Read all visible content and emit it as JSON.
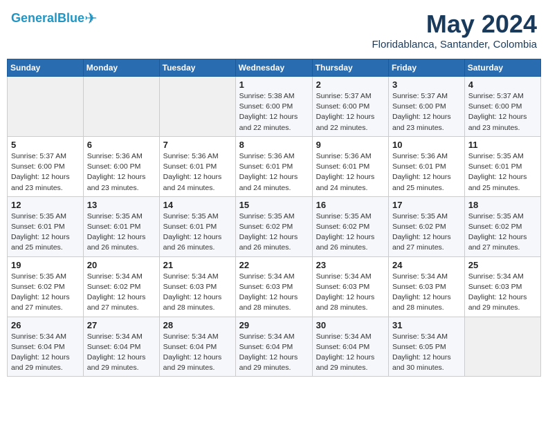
{
  "header": {
    "logo_general": "General",
    "logo_blue": "Blue",
    "month": "May 2024",
    "location": "Floridablanca, Santander, Colombia"
  },
  "weekdays": [
    "Sunday",
    "Monday",
    "Tuesday",
    "Wednesday",
    "Thursday",
    "Friday",
    "Saturday"
  ],
  "weeks": [
    [
      {
        "day": "",
        "info": ""
      },
      {
        "day": "",
        "info": ""
      },
      {
        "day": "",
        "info": ""
      },
      {
        "day": "1",
        "info": "Sunrise: 5:38 AM\nSunset: 6:00 PM\nDaylight: 12 hours\nand 22 minutes."
      },
      {
        "day": "2",
        "info": "Sunrise: 5:37 AM\nSunset: 6:00 PM\nDaylight: 12 hours\nand 22 minutes."
      },
      {
        "day": "3",
        "info": "Sunrise: 5:37 AM\nSunset: 6:00 PM\nDaylight: 12 hours\nand 23 minutes."
      },
      {
        "day": "4",
        "info": "Sunrise: 5:37 AM\nSunset: 6:00 PM\nDaylight: 12 hours\nand 23 minutes."
      }
    ],
    [
      {
        "day": "5",
        "info": "Sunrise: 5:37 AM\nSunset: 6:00 PM\nDaylight: 12 hours\nand 23 minutes."
      },
      {
        "day": "6",
        "info": "Sunrise: 5:36 AM\nSunset: 6:00 PM\nDaylight: 12 hours\nand 23 minutes."
      },
      {
        "day": "7",
        "info": "Sunrise: 5:36 AM\nSunset: 6:01 PM\nDaylight: 12 hours\nand 24 minutes."
      },
      {
        "day": "8",
        "info": "Sunrise: 5:36 AM\nSunset: 6:01 PM\nDaylight: 12 hours\nand 24 minutes."
      },
      {
        "day": "9",
        "info": "Sunrise: 5:36 AM\nSunset: 6:01 PM\nDaylight: 12 hours\nand 24 minutes."
      },
      {
        "day": "10",
        "info": "Sunrise: 5:36 AM\nSunset: 6:01 PM\nDaylight: 12 hours\nand 25 minutes."
      },
      {
        "day": "11",
        "info": "Sunrise: 5:35 AM\nSunset: 6:01 PM\nDaylight: 12 hours\nand 25 minutes."
      }
    ],
    [
      {
        "day": "12",
        "info": "Sunrise: 5:35 AM\nSunset: 6:01 PM\nDaylight: 12 hours\nand 25 minutes."
      },
      {
        "day": "13",
        "info": "Sunrise: 5:35 AM\nSunset: 6:01 PM\nDaylight: 12 hours\nand 26 minutes."
      },
      {
        "day": "14",
        "info": "Sunrise: 5:35 AM\nSunset: 6:01 PM\nDaylight: 12 hours\nand 26 minutes."
      },
      {
        "day": "15",
        "info": "Sunrise: 5:35 AM\nSunset: 6:02 PM\nDaylight: 12 hours\nand 26 minutes."
      },
      {
        "day": "16",
        "info": "Sunrise: 5:35 AM\nSunset: 6:02 PM\nDaylight: 12 hours\nand 26 minutes."
      },
      {
        "day": "17",
        "info": "Sunrise: 5:35 AM\nSunset: 6:02 PM\nDaylight: 12 hours\nand 27 minutes."
      },
      {
        "day": "18",
        "info": "Sunrise: 5:35 AM\nSunset: 6:02 PM\nDaylight: 12 hours\nand 27 minutes."
      }
    ],
    [
      {
        "day": "19",
        "info": "Sunrise: 5:35 AM\nSunset: 6:02 PM\nDaylight: 12 hours\nand 27 minutes."
      },
      {
        "day": "20",
        "info": "Sunrise: 5:34 AM\nSunset: 6:02 PM\nDaylight: 12 hours\nand 27 minutes."
      },
      {
        "day": "21",
        "info": "Sunrise: 5:34 AM\nSunset: 6:03 PM\nDaylight: 12 hours\nand 28 minutes."
      },
      {
        "day": "22",
        "info": "Sunrise: 5:34 AM\nSunset: 6:03 PM\nDaylight: 12 hours\nand 28 minutes."
      },
      {
        "day": "23",
        "info": "Sunrise: 5:34 AM\nSunset: 6:03 PM\nDaylight: 12 hours\nand 28 minutes."
      },
      {
        "day": "24",
        "info": "Sunrise: 5:34 AM\nSunset: 6:03 PM\nDaylight: 12 hours\nand 28 minutes."
      },
      {
        "day": "25",
        "info": "Sunrise: 5:34 AM\nSunset: 6:03 PM\nDaylight: 12 hours\nand 29 minutes."
      }
    ],
    [
      {
        "day": "26",
        "info": "Sunrise: 5:34 AM\nSunset: 6:04 PM\nDaylight: 12 hours\nand 29 minutes."
      },
      {
        "day": "27",
        "info": "Sunrise: 5:34 AM\nSunset: 6:04 PM\nDaylight: 12 hours\nand 29 minutes."
      },
      {
        "day": "28",
        "info": "Sunrise: 5:34 AM\nSunset: 6:04 PM\nDaylight: 12 hours\nand 29 minutes."
      },
      {
        "day": "29",
        "info": "Sunrise: 5:34 AM\nSunset: 6:04 PM\nDaylight: 12 hours\nand 29 minutes."
      },
      {
        "day": "30",
        "info": "Sunrise: 5:34 AM\nSunset: 6:04 PM\nDaylight: 12 hours\nand 29 minutes."
      },
      {
        "day": "31",
        "info": "Sunrise: 5:34 AM\nSunset: 6:05 PM\nDaylight: 12 hours\nand 30 minutes."
      },
      {
        "day": "",
        "info": ""
      }
    ]
  ]
}
